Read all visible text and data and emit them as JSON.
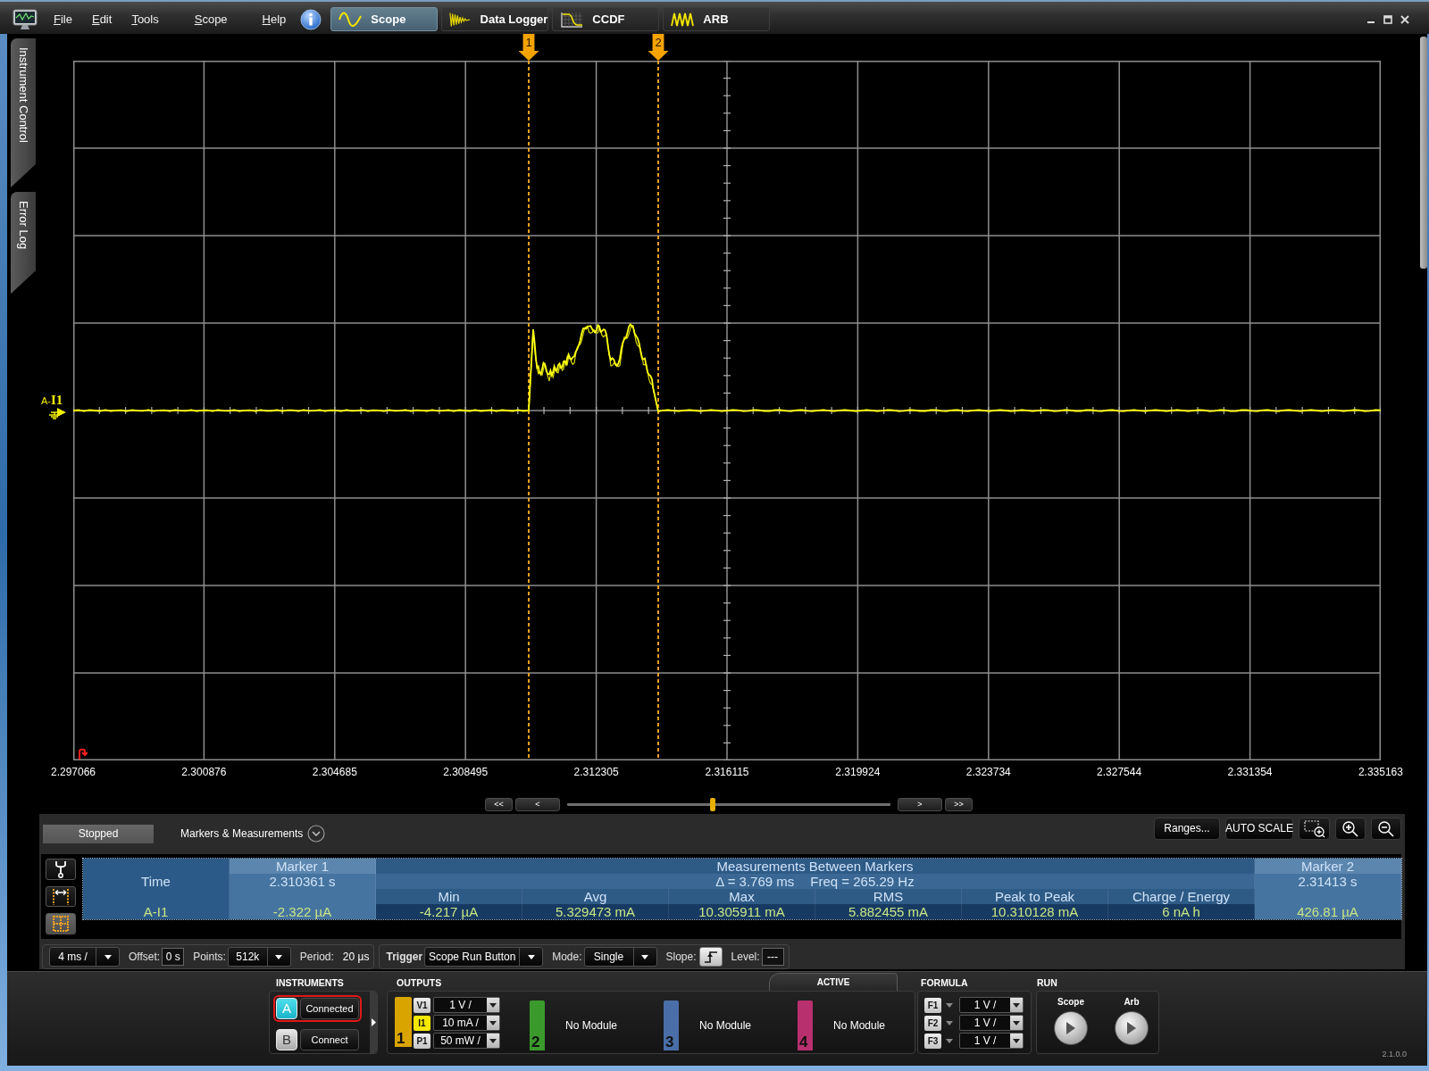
{
  "menu_bar": [
    "File",
    "Edit",
    "Tools",
    "Scope",
    "Help"
  ],
  "mode_tabs": [
    {
      "label": "Scope",
      "kind": "sine",
      "selected": true
    },
    {
      "label": "Data Logger",
      "kind": "logger",
      "selected": false
    },
    {
      "label": "CCDF",
      "kind": "ccdf",
      "selected": false
    },
    {
      "label": "ARB",
      "kind": "arb",
      "selected": false
    }
  ],
  "side_tabs": [
    "Instrument Control",
    "Error Log"
  ],
  "plot": {
    "channel_label": "A-**I1**",
    "markers": [
      {
        "label": "1"
      },
      {
        "label": "2"
      }
    ],
    "time_axis": [
      "2.297066",
      "2.300876",
      "2.304685",
      "2.308495",
      "2.312305",
      "2.316115",
      "2.319924",
      "2.323734",
      "2.327544",
      "2.331354",
      "2.335163"
    ]
  },
  "timeline": {
    "back_buttons": [
      "<<",
      "<"
    ],
    "position": {
      "level": 0.45
    },
    "forward_buttons": [
      ">",
      ">>"
    ]
  },
  "measurements": {
    "status": "Stopped",
    "title": "Markers & Measurements",
    "buttons": [
      "Ranges...",
      "AUTO SCALE"
    ],
    "view_buttons": [
      {
        "kind": "probe",
        "selected": false
      },
      {
        "kind": "markers",
        "selected": false
      },
      {
        "kind": "grid",
        "selected": true
      }
    ],
    "table": {
      "marker_1_header": "Marker 1",
      "between_header": "Measurements Between Markers",
      "marker_2_header": "Marker 2",
      "time_label": "Time",
      "marker_1_time": "2.310361 s",
      "delta": "Δ = 3.769 ms",
      "freq": "Freq = 265.29 Hz",
      "marker_2_time": "2.31413 s",
      "columns": [
        "Min",
        "Avg",
        "Max",
        "RMS",
        "Peak to Peak",
        "Charge / Energy"
      ],
      "rows": [
        {
          "label": "A-I1",
          "marker_1": "-2.322 µA",
          "values": [
            "-4.217 µA",
            "5.329473 mA",
            "10.305911 mA",
            "5.882455 mA",
            "10.310128 mA",
            "6 nA h"
          ],
          "marker_2": "426.81 µA"
        }
      ]
    }
  },
  "acquisition": {
    "timebase": "4 ms /",
    "offset_label": "Offset:",
    "offset": "0 s",
    "points_label": "Points:",
    "points": "512k",
    "period_label": "Period:",
    "period": "20 µs",
    "trigger_label": "Trigger",
    "trigger_source": "Scope Run Button",
    "mode_label": "Mode:",
    "mode": "Single",
    "slope_label": "Slope:",
    "trigger_level_label": "Level:",
    "trigger_level": "---"
  },
  "dock": {
    "instruments": {
      "title": "INSTRUMENTS",
      "items": [
        {
          "letter": "A",
          "status": "Connected",
          "connected": true
        },
        {
          "letter": "B",
          "status": "Connect",
          "connected": false
        }
      ]
    },
    "outputs": {
      "title": "OUTPUTS",
      "active_tab": "ACTIVE",
      "channels": [
        {
          "number": "1",
          "kind": "source",
          "color": "#d9a300",
          "ranges": [
            {
              "badge": "V1",
              "value": "1 V /",
              "selected": false
            },
            {
              "badge": "I1",
              "value": "10 mA /",
              "selected": true
            },
            {
              "badge": "P1",
              "value": "50 mW /",
              "selected": false
            }
          ]
        },
        {
          "number": "2",
          "kind": "empty",
          "color": "#3a9a2c",
          "module": "No Module"
        },
        {
          "number": "3",
          "kind": "empty",
          "color": "#4a6ea8",
          "module": "No Module"
        },
        {
          "number": "4",
          "kind": "empty",
          "color": "#b8306e",
          "module": "No Module"
        }
      ]
    },
    "formula": {
      "title": "FORMULA",
      "items": [
        {
          "badge": "F1",
          "value": "1 V /"
        },
        {
          "badge": "F2",
          "value": "1 V /"
        },
        {
          "badge": "F3",
          "value": "1 V /"
        }
      ]
    },
    "run": {
      "title": "RUN",
      "buttons": [
        "Scope",
        "Arb"
      ]
    },
    "version": "2.1.0.0"
  }
}
